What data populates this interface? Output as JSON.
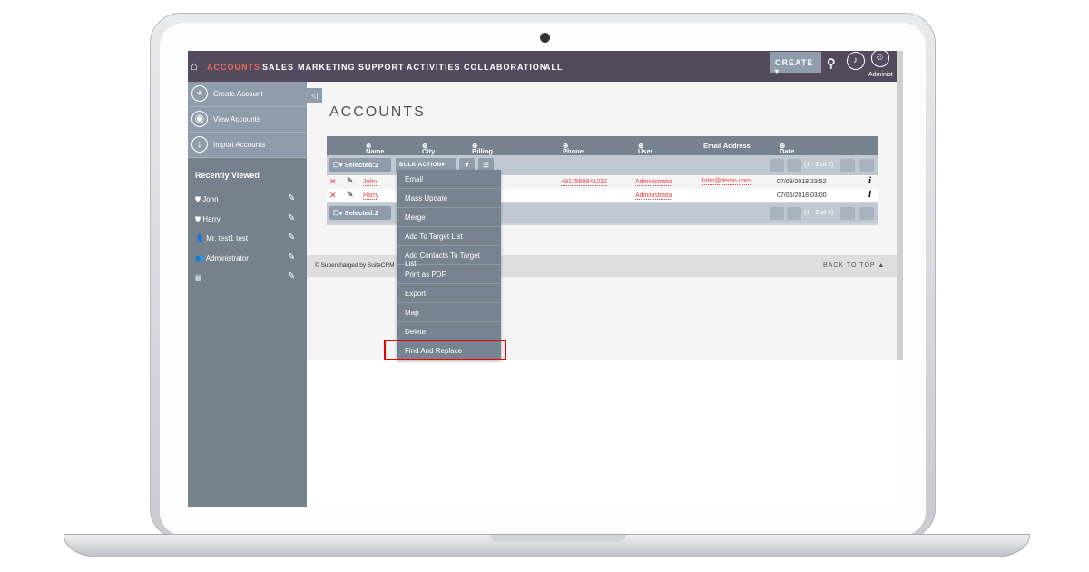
{
  "nav": {
    "items": [
      "ACCOUNTS",
      "SALES",
      "MARKETING",
      "SUPPORT",
      "ACTIVITIES",
      "COLLABORATION",
      "ALL"
    ],
    "create": "CREATE",
    "user": "Administ",
    "accent": "#e8685a"
  },
  "sidebar": {
    "actions": [
      "Create Account",
      "View Accounts",
      "Import Accounts"
    ],
    "recent_title": "Recently Viewed",
    "recent": [
      "John",
      "Harry",
      "Mr. test1 test",
      "Administrator",
      ""
    ]
  },
  "page_title": "ACCOUNTS",
  "table": {
    "columns": [
      "Name",
      "City",
      "Billing Country",
      "Phone",
      "User",
      "Email Address",
      "Date Created"
    ],
    "selected": "Selected:2",
    "bulk": "BULK ACTION",
    "pagination": "(1 - 2 of 2)",
    "rows": [
      {
        "name": "John",
        "phone": "+917569841232",
        "user": "Administrator",
        "email": "John@demo.com",
        "date": "07/09/2018 23:52"
      },
      {
        "name": "Harry",
        "phone": "",
        "user": "Administrator",
        "email": "",
        "date": "07/05/2018 03:00"
      }
    ]
  },
  "menu": [
    "Email",
    "Mass Update",
    "Merge",
    "Add To Target List",
    "Add Contacts To Target List",
    "Print as PDF",
    "Export",
    "Map",
    "Delete",
    "Find And Replace"
  ],
  "footer": {
    "credit": "© Supercharged by SuiteCRM",
    "back": "BACK TO TOP"
  }
}
